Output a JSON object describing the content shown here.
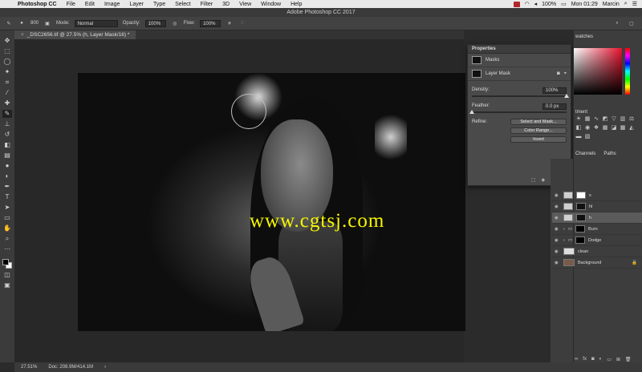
{
  "menubar": {
    "apple": "",
    "items": [
      "Photoshop CC",
      "File",
      "Edit",
      "Image",
      "Layer",
      "Type",
      "Select",
      "Filter",
      "3D",
      "View",
      "Window",
      "Help"
    ],
    "tray_time": "Mon 01:29",
    "tray_user": "Marcin",
    "battery": "100%"
  },
  "window": {
    "title": "Adobe Photoshop CC 2017"
  },
  "options": {
    "brush_size": "800",
    "mode_label": "Mode:",
    "mode_value": "Normal",
    "opacity_label": "Opacity:",
    "opacity_value": "100%",
    "flow_label": "Flow:",
    "flow_value": "100%"
  },
  "document_tab": {
    "label": "_DSC2656.tif @ 27.5% (h, Layer Mask/16) *"
  },
  "watermark": "www.cgtsj.com",
  "status": {
    "zoom": "27.51%",
    "doc": "Doc: 208.9M/414.1M"
  },
  "properties": {
    "title": "Properties",
    "masks_label": "Masks",
    "layer_mask_label": "Layer Mask",
    "density_label": "Density:",
    "density_value": "100%",
    "density_level": 1.0,
    "feather_label": "Feather:",
    "feather_value": "0.0 px",
    "feather_level": 0.0,
    "refine_label": "Refine:",
    "btn_select_mask": "Select and Mask...",
    "btn_color_range": "Color Range...",
    "btn_invert": "Invert"
  },
  "right_panel": {
    "swatches_tab": "watches",
    "adjustments_label": "tment",
    "channels_tab": "Channels",
    "paths_tab": "Paths"
  },
  "layers": [
    {
      "name": "s",
      "type": "adjustment"
    },
    {
      "name": "hl",
      "type": "adjustment"
    },
    {
      "name": "h",
      "type": "adjustment",
      "selected": true
    },
    {
      "name": "Burn",
      "type": "group"
    },
    {
      "name": "Dodge",
      "type": "group"
    },
    {
      "name": "clean",
      "type": "pixel"
    },
    {
      "name": "Background",
      "type": "background",
      "locked": true
    }
  ],
  "colors": {
    "accent_red": "#e8132f",
    "watermark": "#f5f500"
  }
}
